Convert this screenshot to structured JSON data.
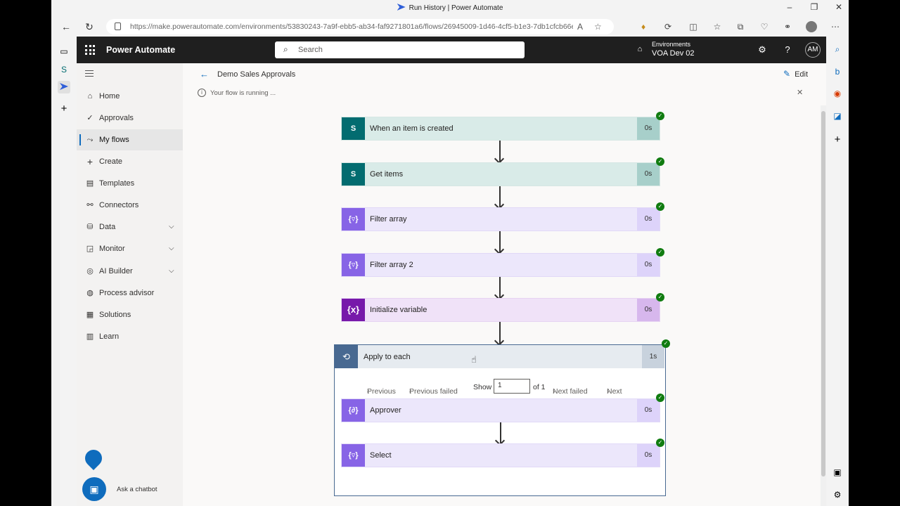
{
  "browser": {
    "tab_title": "Run History | Power Automate",
    "url_host": "https://make.powerautomate.com",
    "url_path": "/environments/53830243-7a9f-ebb5-ab34-faf9271801a6/flows/26945009-1d46-4cf5-b1e3-7db1cfcb66e",
    "window_controls": [
      "–",
      "❐",
      "✕"
    ]
  },
  "app": {
    "name": "Power Automate",
    "search_placeholder": "Search",
    "environment_label": "Environments",
    "environment_value": "VOA Dev 02",
    "avatar_initials": "AM"
  },
  "nav": {
    "items": [
      {
        "label": "Home",
        "icon": "home-icon"
      },
      {
        "label": "Approvals",
        "icon": "approvals-icon"
      },
      {
        "label": "My flows",
        "icon": "flows-icon"
      },
      {
        "label": "Create",
        "icon": "plus-icon"
      },
      {
        "label": "Templates",
        "icon": "templates-icon"
      },
      {
        "label": "Connectors",
        "icon": "connectors-icon"
      },
      {
        "label": "Data",
        "icon": "data-icon"
      },
      {
        "label": "Monitor",
        "icon": "monitor-icon"
      },
      {
        "label": "AI Builder",
        "icon": "ai-builder-icon"
      },
      {
        "label": "Process advisor",
        "icon": "process-advisor-icon"
      },
      {
        "label": "Solutions",
        "icon": "solutions-icon"
      },
      {
        "label": "Learn",
        "icon": "learn-icon"
      }
    ],
    "chatbot_label": "Ask a chatbot"
  },
  "main": {
    "flow_name": "Demo Sales Approvals",
    "edit_label": "Edit",
    "info_text": "Your flow is running ...",
    "steps": [
      {
        "label": "When an item is created",
        "duration": "0s",
        "kind": "sharepoint",
        "icon_text": "S"
      },
      {
        "label": "Get items",
        "duration": "0s",
        "kind": "sharepoint",
        "icon_text": "S"
      },
      {
        "label": "Filter array",
        "duration": "0s",
        "kind": "filter",
        "icon_text": "{▿}"
      },
      {
        "label": "Filter array 2",
        "duration": "0s",
        "kind": "filter",
        "icon_text": "{▿}"
      },
      {
        "label": "Initialize variable",
        "duration": "0s",
        "kind": "variable",
        "icon_text": "{x}"
      }
    ],
    "apply_to_each": {
      "label": "Apply to each",
      "duration": "1s",
      "pager": {
        "previous": "Previous",
        "previous_failed": "Previous failed",
        "show": "Show",
        "page_value": "1",
        "of_total": "of 1",
        "next_failed": "Next failed",
        "next": "Next"
      },
      "steps": [
        {
          "label": "Approver",
          "duration": "0s",
          "kind": "filter",
          "icon_text": "{∂}"
        },
        {
          "label": "Select",
          "duration": "0s",
          "kind": "filter",
          "icon_text": "{▿}"
        }
      ]
    }
  },
  "colors": {
    "header_bg": "#1f1f1f",
    "accent": "#0f6cbd",
    "success": "#107c10",
    "sharepoint": "#036c70",
    "filter": "#8764e6",
    "variable": "#7719aa",
    "loop": "#486991"
  }
}
